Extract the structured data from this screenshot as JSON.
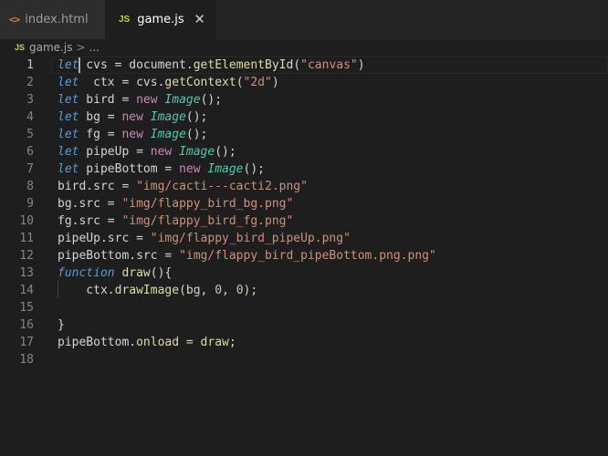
{
  "tabs": [
    {
      "label": "index.html",
      "icon": "html-file-icon",
      "icon_glyph": "<>",
      "active": false
    },
    {
      "label": "game.js",
      "icon": "js-file-icon",
      "icon_glyph": "JS",
      "active": true,
      "close_glyph": "✕"
    }
  ],
  "breadcrumb": {
    "icon_glyph": "JS",
    "file": "game.js",
    "separator": ">",
    "symbol": "..."
  },
  "colors": {
    "background": "#1e1e1e",
    "keyword": "#569cd6",
    "class": "#4ec9b0",
    "new_keyword": "#c586c0",
    "string": "#ce9178",
    "number": "#b5cea8",
    "method": "#dcdcaa",
    "property": "#9cdcfe"
  },
  "editor": {
    "current_line": 1,
    "lines": [
      {
        "n": "1",
        "tokens": [
          [
            "kw",
            "let"
          ],
          [
            "cursor",
            ""
          ],
          [
            "plain",
            " cvs "
          ],
          [
            "op",
            "="
          ],
          [
            "plain",
            " document."
          ],
          [
            "mth",
            "getElementById"
          ],
          [
            "plain",
            "("
          ],
          [
            "str",
            "\"canvas\""
          ],
          [
            "plain",
            ")"
          ]
        ]
      },
      {
        "n": "2",
        "tokens": [
          [
            "kw",
            "let"
          ],
          [
            "plain",
            "  ctx "
          ],
          [
            "op",
            "="
          ],
          [
            "plain",
            " cvs."
          ],
          [
            "mth",
            "getContext"
          ],
          [
            "plain",
            "("
          ],
          [
            "str",
            "\"2d\""
          ],
          [
            "plain",
            ")"
          ]
        ]
      },
      {
        "n": "3",
        "tokens": [
          [
            "kw",
            "let"
          ],
          [
            "plain",
            " bird "
          ],
          [
            "op",
            "="
          ],
          [
            "plain",
            " "
          ],
          [
            "new",
            "new"
          ],
          [
            "plain",
            " "
          ],
          [
            "cls",
            "Image"
          ],
          [
            "plain",
            "();"
          ]
        ]
      },
      {
        "n": "4",
        "tokens": [
          [
            "kw",
            "let"
          ],
          [
            "plain",
            " bg "
          ],
          [
            "op",
            "="
          ],
          [
            "plain",
            " "
          ],
          [
            "new",
            "new"
          ],
          [
            "plain",
            " "
          ],
          [
            "cls",
            "Image"
          ],
          [
            "plain",
            "();"
          ]
        ]
      },
      {
        "n": "5",
        "tokens": [
          [
            "kw",
            "let"
          ],
          [
            "plain",
            " fg "
          ],
          [
            "op",
            "="
          ],
          [
            "plain",
            " "
          ],
          [
            "new",
            "new"
          ],
          [
            "plain",
            " "
          ],
          [
            "cls",
            "Image"
          ],
          [
            "plain",
            "();"
          ]
        ]
      },
      {
        "n": "6",
        "tokens": [
          [
            "kw",
            "let"
          ],
          [
            "plain",
            " pipeUp "
          ],
          [
            "op",
            "="
          ],
          [
            "plain",
            " "
          ],
          [
            "new",
            "new"
          ],
          [
            "plain",
            " "
          ],
          [
            "cls",
            "Image"
          ],
          [
            "plain",
            "();"
          ]
        ]
      },
      {
        "n": "7",
        "tokens": [
          [
            "kw",
            "let"
          ],
          [
            "plain",
            " pipeBottom "
          ],
          [
            "op",
            "="
          ],
          [
            "plain",
            " "
          ],
          [
            "new",
            "new"
          ],
          [
            "plain",
            " "
          ],
          [
            "cls",
            "Image"
          ],
          [
            "plain",
            "();"
          ]
        ]
      },
      {
        "n": "8",
        "tokens": [
          [
            "plain",
            "bird.src "
          ],
          [
            "op",
            "="
          ],
          [
            "plain",
            " "
          ],
          [
            "str",
            "\"img/cacti---cacti2.png\""
          ]
        ]
      },
      {
        "n": "9",
        "tokens": [
          [
            "plain",
            "bg.src "
          ],
          [
            "op",
            "="
          ],
          [
            "plain",
            " "
          ],
          [
            "str",
            "\"img/flappy_bird_bg.png\""
          ]
        ]
      },
      {
        "n": "10",
        "tokens": [
          [
            "plain",
            "fg.src "
          ],
          [
            "op",
            "="
          ],
          [
            "plain",
            " "
          ],
          [
            "str",
            "\"img/flappy_bird_fg.png\""
          ]
        ]
      },
      {
        "n": "11",
        "tokens": [
          [
            "plain",
            "pipeUp.src "
          ],
          [
            "op",
            "="
          ],
          [
            "plain",
            " "
          ],
          [
            "str",
            "\"img/flappy_bird_pipeUp.png\""
          ]
        ]
      },
      {
        "n": "12",
        "tokens": [
          [
            "plain",
            "pipeBottom.src "
          ],
          [
            "op",
            "="
          ],
          [
            "plain",
            " "
          ],
          [
            "str",
            "\"img/flappy_bird_pipeBottom.png.png\""
          ]
        ]
      },
      {
        "n": "13",
        "tokens": [
          [
            "fnk",
            "function"
          ],
          [
            "plain",
            " "
          ],
          [
            "mth",
            "draw"
          ],
          [
            "plain",
            "(){"
          ]
        ]
      },
      {
        "n": "14",
        "tokens": [
          [
            "plain",
            "    ctx."
          ],
          [
            "mth",
            "drawImage"
          ],
          [
            "plain",
            "(bg, "
          ],
          [
            "num",
            "0"
          ],
          [
            "plain",
            ", "
          ],
          [
            "num",
            "0"
          ],
          [
            "plain",
            ");"
          ]
        ]
      },
      {
        "n": "15",
        "tokens": []
      },
      {
        "n": "16",
        "tokens": [
          [
            "plain",
            "}"
          ]
        ]
      },
      {
        "n": "17",
        "tokens": [
          [
            "plain",
            "pipeBottom."
          ],
          [
            "mth",
            "onload"
          ],
          [
            "plain",
            " "
          ],
          [
            "op",
            "="
          ],
          [
            "plain",
            " "
          ],
          [
            "mth",
            "draw"
          ],
          [
            "plain",
            ";"
          ]
        ]
      },
      {
        "n": "18",
        "tokens": []
      }
    ]
  }
}
